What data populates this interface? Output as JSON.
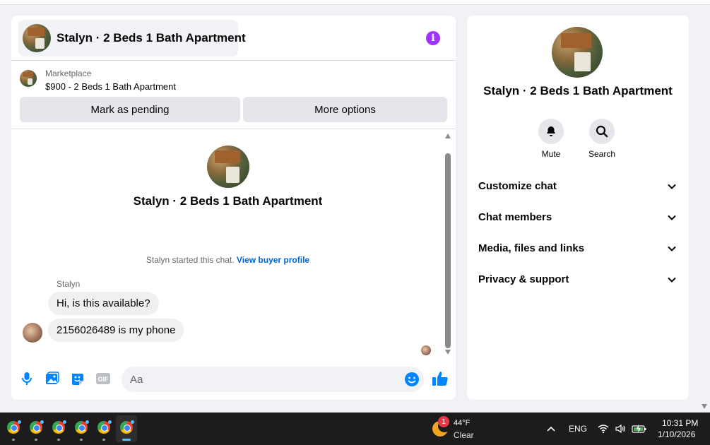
{
  "chat": {
    "title": "Stalyn · 2 Beds 1 Bath Apartment",
    "marketplace": {
      "label": "Marketplace",
      "listing": "$900 - 2 Beds 1 Bath Apartment",
      "mark_pending_label": "Mark as pending",
      "more_options_label": "More options"
    },
    "intro": {
      "title": "Stalyn · 2 Beds 1 Bath Apartment",
      "started_text": "Stalyn started this chat.",
      "view_profile_link": "View buyer profile"
    },
    "messages": {
      "sender": "Stalyn",
      "items": [
        "Hi, is this available?",
        "2156026489 is my phone"
      ]
    },
    "composer": {
      "placeholder": "Aa",
      "icons": [
        "microphone-icon",
        "photo-icon",
        "sticker-icon",
        "gif-icon",
        "emoji-icon",
        "thumbs-up-icon"
      ]
    }
  },
  "sidebar": {
    "title": "Stalyn · 2 Beds 1 Bath Apartment",
    "actions": [
      {
        "label": "Mute",
        "icon": "bell-icon"
      },
      {
        "label": "Search",
        "icon": "search-icon"
      }
    ],
    "menu": [
      {
        "label": "Customize chat"
      },
      {
        "label": "Chat members"
      },
      {
        "label": "Media, files and links"
      },
      {
        "label": "Privacy & support"
      }
    ]
  },
  "taskbar": {
    "apps": [
      "chrome",
      "chrome",
      "chrome",
      "chrome",
      "chrome",
      "chrome"
    ],
    "weather": {
      "badge": "1",
      "temp": "44°F",
      "condition": "Clear"
    },
    "language": "ENG",
    "time": "10:31 PM",
    "date": "1/10/2026"
  },
  "colors": {
    "accent_blue": "#0084ff",
    "link_blue": "#0064d1",
    "info_purple": "#a033ff",
    "bubble_gray": "#f0f0f0",
    "panel_bg": "#f0f2f5"
  }
}
